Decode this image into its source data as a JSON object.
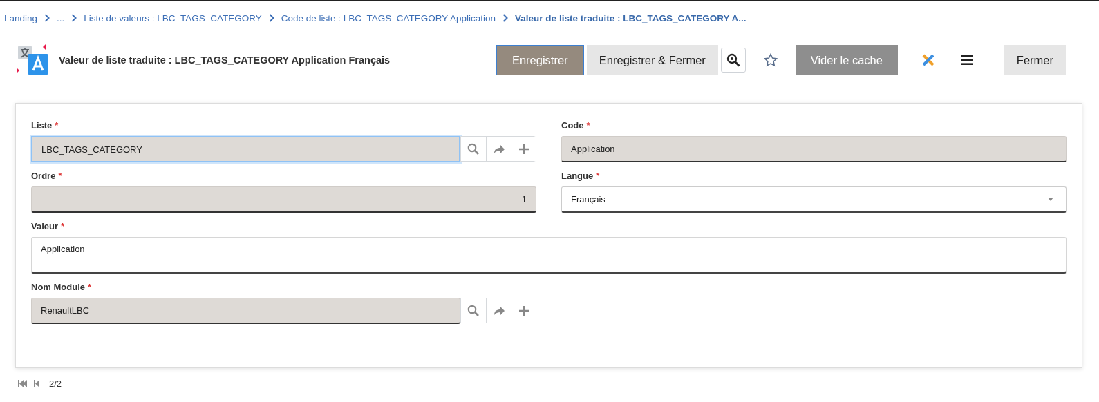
{
  "breadcrumb": [
    {
      "label": "Landing",
      "current": false
    },
    {
      "label": "...",
      "current": false
    },
    {
      "label": "Liste de valeurs : LBC_TAGS_CATEGORY",
      "current": false
    },
    {
      "label": "Code de liste : LBC_TAGS_CATEGORY Application",
      "current": false
    },
    {
      "label": "Valeur de liste traduite : LBC_TAGS_CATEGORY A...",
      "current": true
    }
  ],
  "header": {
    "title": "Valeur de liste traduite : LBC_TAGS_CATEGORY Application Français"
  },
  "toolbar": [
    {
      "kind": "primary",
      "label": "Enregistrer"
    },
    {
      "kind": "secondary",
      "label": "Enregistrer & Fermer"
    },
    {
      "kind": "search"
    },
    {
      "kind": "star"
    },
    {
      "kind": "dark",
      "label": "Vider le cache"
    },
    {
      "kind": "tool"
    },
    {
      "kind": "menu"
    },
    {
      "kind": "secondary",
      "label": "Fermer"
    }
  ],
  "fields": [
    {
      "kind": "lookup",
      "label": "Liste",
      "required_mark": "*",
      "value": "LBC_TAGS_CATEGORY",
      "readonly": true,
      "focused": true
    },
    {
      "kind": "text",
      "label": "Code",
      "required_mark": "*",
      "value": "Application",
      "readonly": true,
      "focused": false
    },
    {
      "kind": "number",
      "label": "Ordre",
      "required_mark": "*",
      "value": "1",
      "readonly": true,
      "focused": false
    },
    {
      "kind": "select",
      "label": "Langue",
      "required_mark": "*",
      "value": "Français",
      "readonly": false,
      "focused": false
    },
    {
      "kind": "textarea",
      "label": "Valeur",
      "required_mark": "*",
      "value": "Application",
      "readonly": false,
      "focused": false
    },
    {
      "kind": "lookup",
      "label": "Nom Module",
      "required_mark": "*",
      "value": "RenaultLBC",
      "readonly": true,
      "focused": false
    }
  ],
  "pager": {
    "position": "2/2"
  }
}
